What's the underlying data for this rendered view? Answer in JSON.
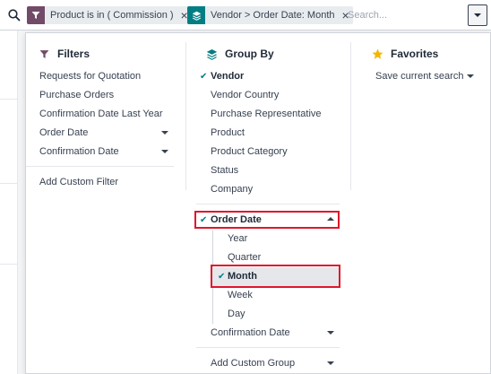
{
  "search": {
    "facets": [
      {
        "label": "Product is in ( Commission )",
        "icon": "filter-icon",
        "color": "#714b67"
      },
      {
        "label": "Vendor > Order Date: Month",
        "icon": "layers-icon",
        "color": "#017e84"
      }
    ],
    "placeholder": "Search..."
  },
  "filters": {
    "title": "Filters",
    "items": [
      "Requests for Quotation",
      "Purchase Orders",
      "Confirmation Date Last Year",
      "Order Date",
      "Confirmation Date"
    ],
    "add_custom": "Add Custom Filter"
  },
  "group_by": {
    "title": "Group By",
    "items": [
      "Vendor",
      "Vendor Country",
      "Purchase Representative",
      "Product",
      "Product Category",
      "Status",
      "Company"
    ],
    "order_date": "Order Date",
    "order_date_options": [
      "Year",
      "Quarter",
      "Month",
      "Week",
      "Day"
    ],
    "confirmation_date": "Confirmation Date",
    "add_custom": "Add Custom Group"
  },
  "favorites": {
    "title": "Favorites",
    "save_current": "Save current search"
  },
  "colors": {
    "accent": "#017e84",
    "filter_facet": "#714b67",
    "highlight": "#e0162b",
    "favorite_star": "#f3b700"
  }
}
